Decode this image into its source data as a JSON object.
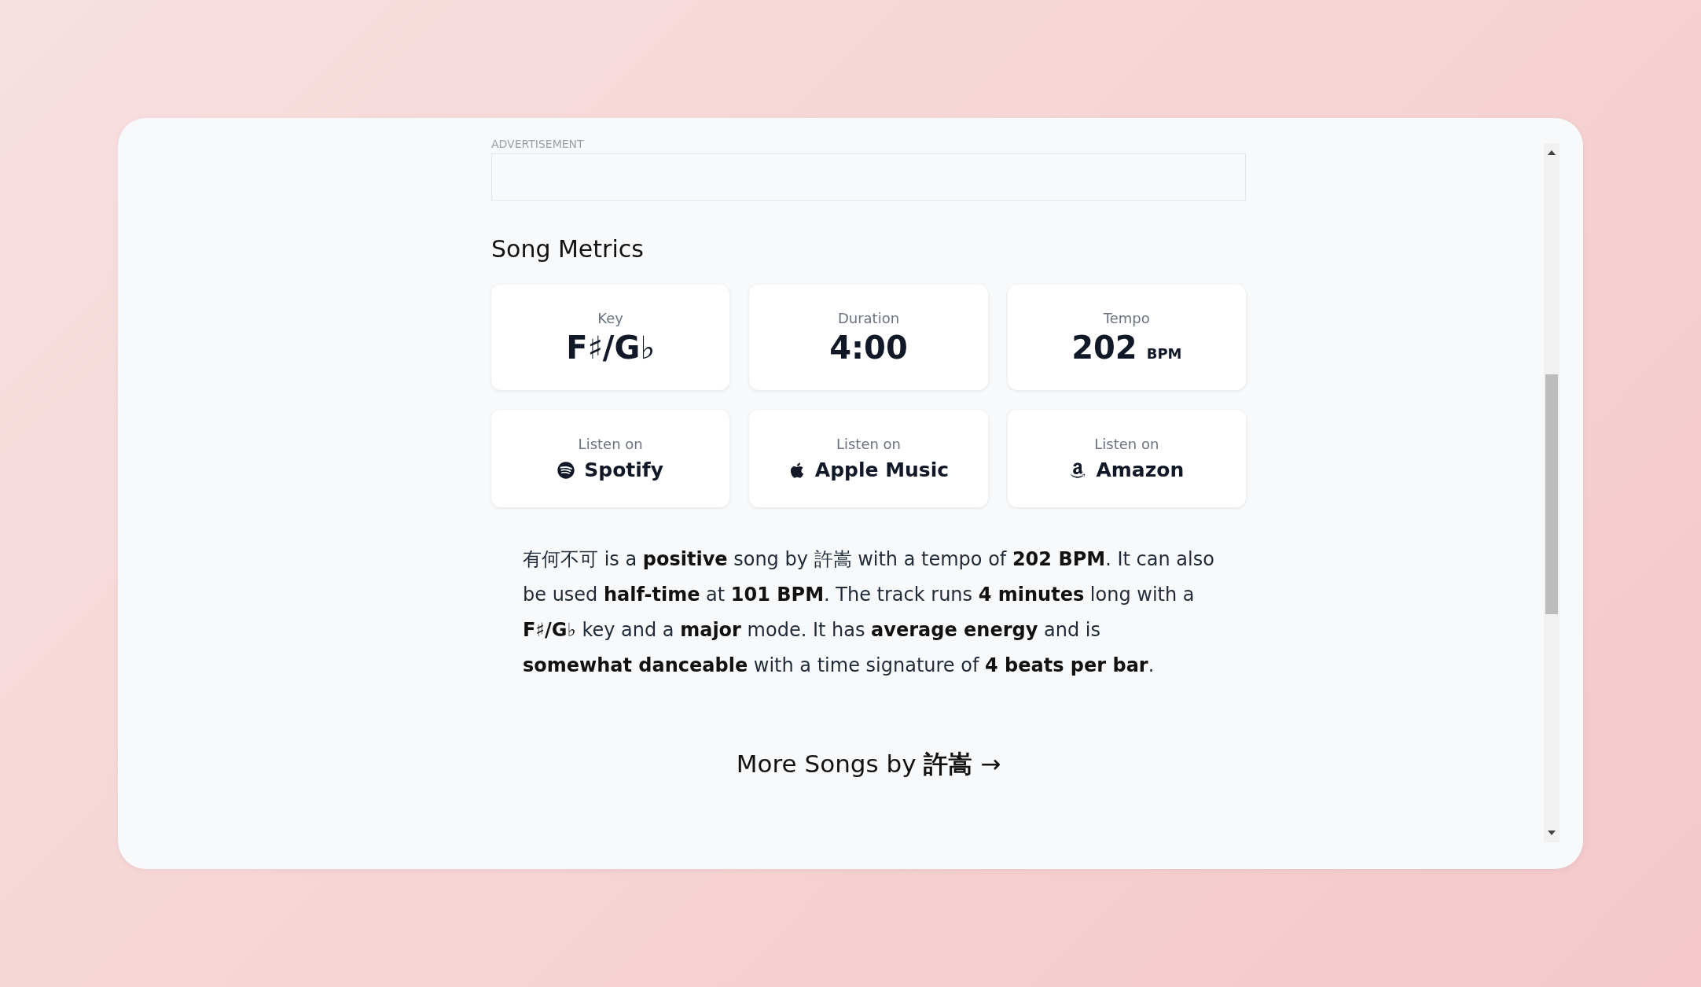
{
  "ad": {
    "label": "ADVERTISEMENT"
  },
  "section_title": "Song Metrics",
  "metrics": [
    {
      "label": "Key",
      "value": "F♯/G♭"
    },
    {
      "label": "Duration",
      "value": "4:00"
    },
    {
      "label": "Tempo",
      "value": "202",
      "unit": "BPM"
    }
  ],
  "listen_links": [
    {
      "label": "Listen on",
      "service": "Spotify",
      "kind": "spotify"
    },
    {
      "label": "Listen on",
      "service": "Apple Music",
      "kind": "apple"
    },
    {
      "label": "Listen on",
      "service": "Amazon",
      "kind": "amazon"
    }
  ],
  "description": "有何不可 is a **positive** song by 許嵩 with a tempo of **202 BPM**. It can also be used **half-time** at **101 BPM**. The track runs **4 minutes** long with a **F♯/G♭** key and a **major** mode. It has **average energy** and is **somewhat danceable** with a time signature of **4 beats per bar**.",
  "more_link": "More Songs by **許嵩** →"
}
